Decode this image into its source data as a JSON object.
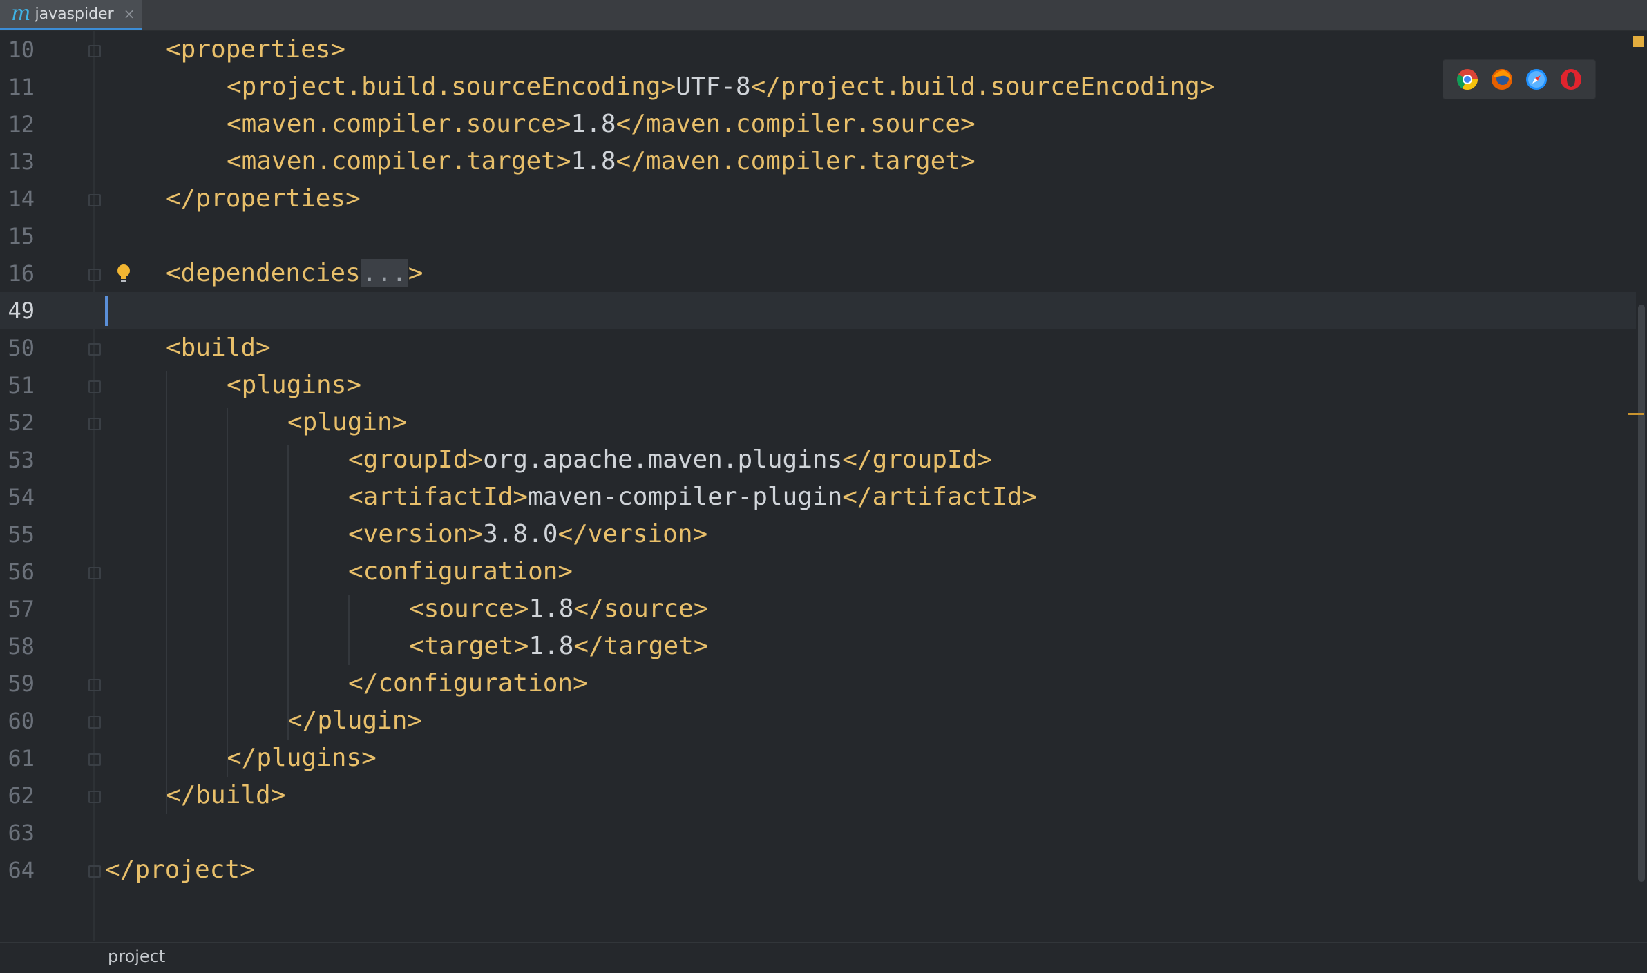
{
  "tab": {
    "icon_glyph": "m",
    "title": "javaspider",
    "close_glyph": "×"
  },
  "editor": {
    "lines": [
      {
        "num": "10",
        "indent": 1,
        "parts": [
          {
            "t": "tag",
            "v": "<properties>"
          }
        ],
        "fold": "open"
      },
      {
        "num": "11",
        "indent": 2,
        "parts": [
          {
            "t": "tag",
            "v": "<project.build.sourceEncoding>"
          },
          {
            "t": "txt",
            "v": "UTF-8"
          },
          {
            "t": "tag",
            "v": "</project.build.sourceEncoding>"
          }
        ]
      },
      {
        "num": "12",
        "indent": 2,
        "parts": [
          {
            "t": "tag",
            "v": "<maven.compiler.source>"
          },
          {
            "t": "txt",
            "v": "1.8"
          },
          {
            "t": "tag",
            "v": "</maven.compiler.source>"
          }
        ]
      },
      {
        "num": "13",
        "indent": 2,
        "parts": [
          {
            "t": "tag",
            "v": "<maven.compiler.target>"
          },
          {
            "t": "txt",
            "v": "1.8"
          },
          {
            "t": "tag",
            "v": "</maven.compiler.target>"
          }
        ]
      },
      {
        "num": "14",
        "indent": 1,
        "parts": [
          {
            "t": "tag",
            "v": "</properties>"
          }
        ],
        "fold": "close"
      },
      {
        "num": "15",
        "indent": 0,
        "parts": []
      },
      {
        "num": "16",
        "indent": 1,
        "parts": [
          {
            "t": "tag",
            "v": "<dependencies"
          },
          {
            "t": "dots",
            "v": "..."
          },
          {
            "t": "tag",
            "v": ">"
          }
        ],
        "fold": "collapsed",
        "bulb": true
      },
      {
        "num": "49",
        "indent": 0,
        "parts": [],
        "current": true
      },
      {
        "num": "50",
        "indent": 1,
        "parts": [
          {
            "t": "tag",
            "v": "<build>"
          }
        ],
        "fold": "open"
      },
      {
        "num": "51",
        "indent": 2,
        "parts": [
          {
            "t": "tag",
            "v": "<plugins>"
          }
        ],
        "fold": "open"
      },
      {
        "num": "52",
        "indent": 3,
        "parts": [
          {
            "t": "tag",
            "v": "<plugin>"
          }
        ],
        "fold": "open"
      },
      {
        "num": "53",
        "indent": 4,
        "parts": [
          {
            "t": "tag",
            "v": "<groupId>"
          },
          {
            "t": "txt",
            "v": "org.apache.maven.plugins"
          },
          {
            "t": "tag",
            "v": "</groupId>"
          }
        ]
      },
      {
        "num": "54",
        "indent": 4,
        "parts": [
          {
            "t": "tag",
            "v": "<artifactId>"
          },
          {
            "t": "txt",
            "v": "maven-compiler-plugin"
          },
          {
            "t": "tag",
            "v": "</artifactId>"
          }
        ]
      },
      {
        "num": "55",
        "indent": 4,
        "parts": [
          {
            "t": "tag",
            "v": "<version>"
          },
          {
            "t": "txt",
            "v": "3.8.0"
          },
          {
            "t": "tag",
            "v": "</version>"
          }
        ]
      },
      {
        "num": "56",
        "indent": 4,
        "parts": [
          {
            "t": "tag",
            "v": "<configuration>"
          }
        ],
        "fold": "open"
      },
      {
        "num": "57",
        "indent": 5,
        "parts": [
          {
            "t": "tag",
            "v": "<source>"
          },
          {
            "t": "txt",
            "v": "1.8"
          },
          {
            "t": "tag",
            "v": "</source>"
          }
        ]
      },
      {
        "num": "58",
        "indent": 5,
        "parts": [
          {
            "t": "tag",
            "v": "<target>"
          },
          {
            "t": "txt",
            "v": "1.8"
          },
          {
            "t": "tag",
            "v": "</target>"
          }
        ]
      },
      {
        "num": "59",
        "indent": 4,
        "parts": [
          {
            "t": "tag",
            "v": "</configuration>"
          }
        ],
        "fold": "close"
      },
      {
        "num": "60",
        "indent": 3,
        "parts": [
          {
            "t": "tag",
            "v": "</plugin>"
          }
        ],
        "fold": "close"
      },
      {
        "num": "61",
        "indent": 2,
        "parts": [
          {
            "t": "tag",
            "v": "</plugins>"
          }
        ],
        "fold": "close"
      },
      {
        "num": "62",
        "indent": 1,
        "parts": [
          {
            "t": "tag",
            "v": "</build>"
          }
        ],
        "fold": "close"
      },
      {
        "num": "63",
        "indent": 0,
        "parts": []
      },
      {
        "num": "64",
        "indent": 0,
        "parts": [
          {
            "t": "tag",
            "v": "</project>"
          }
        ],
        "fold": "close"
      }
    ]
  },
  "browser_icons": [
    {
      "name": "chrome-icon",
      "color": "#dd4b39"
    },
    {
      "name": "firefox-icon",
      "color": "#e66000"
    },
    {
      "name": "safari-icon",
      "color": "#1e90ff"
    },
    {
      "name": "opera-icon",
      "color": "#e0242e"
    }
  ],
  "breadcrumb": {
    "label": "project"
  },
  "colors": {
    "tag": "#e8bf6a",
    "text": "#d0d4d9",
    "caret": "#5a8fd8",
    "tab_accent": "#3c8dd6"
  }
}
